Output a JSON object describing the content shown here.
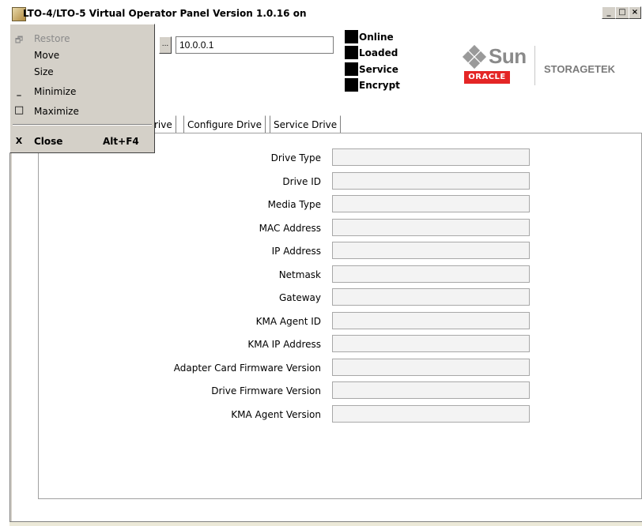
{
  "window": {
    "title": "LTO-4/LTO-5 Virtual Operator Panel Version 1.0.16 on",
    "buttons": {
      "minimize": "_",
      "maximize": "□",
      "close": "×"
    }
  },
  "header": {
    "ip_value": "10.0.0.1",
    "browse_label": "...",
    "status": [
      {
        "label": "Online"
      },
      {
        "label": "Loaded"
      },
      {
        "label": "Service"
      },
      {
        "label": "Encrypt"
      }
    ]
  },
  "logos": {
    "sun": "Sun",
    "oracle": "ORACLE",
    "storagetek": "STORAGETEK"
  },
  "tabs": [
    "rive",
    "Configure Drive",
    "Service Drive"
  ],
  "form": {
    "fields": [
      {
        "label": "Drive Type",
        "value": ""
      },
      {
        "label": "Drive ID",
        "value": ""
      },
      {
        "label": "Media Type",
        "value": ""
      },
      {
        "label": "MAC Address",
        "value": ""
      },
      {
        "label": "IP Address",
        "value": ""
      },
      {
        "label": "Netmask",
        "value": ""
      },
      {
        "label": "Gateway",
        "value": ""
      },
      {
        "label": "KMA Agent ID",
        "value": ""
      },
      {
        "label": "KMA IP Address",
        "value": ""
      },
      {
        "label": "Adapter Card Firmware Version",
        "value": ""
      },
      {
        "label": "Drive Firmware Version",
        "value": ""
      },
      {
        "label": "KMA Agent Version",
        "value": ""
      }
    ]
  },
  "system_menu": {
    "items": [
      {
        "label": "Restore",
        "icon": "restore-icon",
        "glyph": "🗗",
        "disabled": true
      },
      {
        "label": "Move",
        "icon": "",
        "glyph": "",
        "disabled": false
      },
      {
        "label": "Size",
        "icon": "",
        "glyph": "",
        "disabled": false
      },
      {
        "label": "Minimize",
        "icon": "minimize-icon",
        "glyph": "_",
        "disabled": false
      },
      {
        "label": "Maximize",
        "icon": "maximize-icon",
        "glyph": "□",
        "disabled": false
      }
    ],
    "close": {
      "label": "Close",
      "shortcut": "Alt+F4",
      "glyph": "X"
    }
  },
  "colors": {
    "oracle_red": "#e42525",
    "menu_bg": "#d4d0c8",
    "led": "#000000"
  }
}
